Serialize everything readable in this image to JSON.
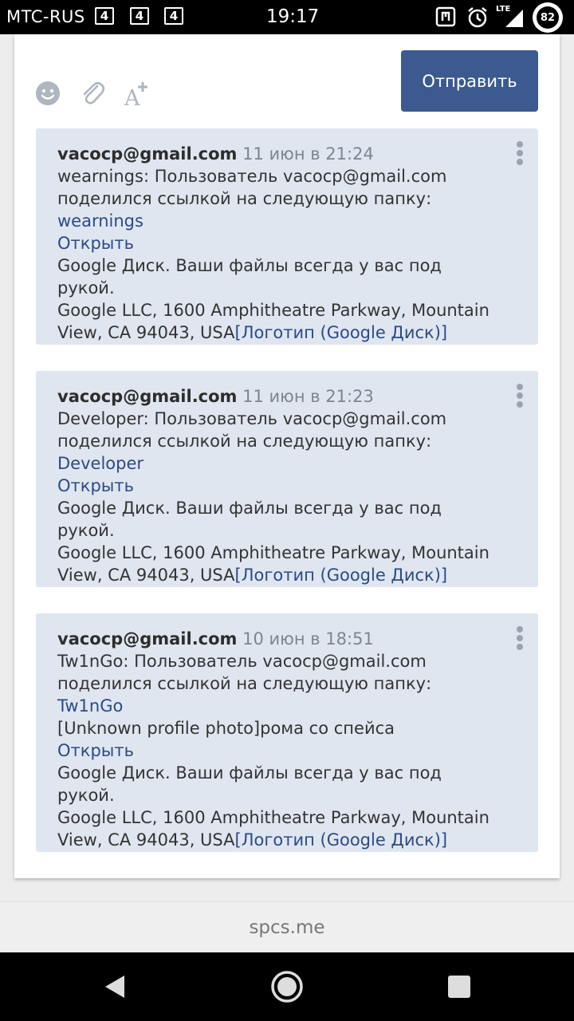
{
  "status_bar": {
    "carrier": "MTC-RUS",
    "network_badges": [
      "4",
      "4",
      "4"
    ],
    "time": "19:17",
    "lte_label": "LTE",
    "battery": "82"
  },
  "composer": {
    "send_label": "Отправить",
    "icons": [
      "smile-icon",
      "paperclip-icon",
      "text-format-icon"
    ]
  },
  "messages": [
    {
      "author": "vacocp@gmail.com",
      "date": "11 июн в 21:24",
      "line1": "wearnings: Пользователь vacocp@gmail.com",
      "line2": "поделился ссылкой на следующую папку:",
      "folder": "wearnings",
      "open": "Открыть",
      "footer1": "Google Диск. Ваши файлы всегда у вас под рукой.",
      "footer2": "Google LLC, 1600 Amphitheatre Parkway, Mountain",
      "footer3": "View, CA 94043, USA",
      "logo": "[Логотип (Google Диск)]"
    },
    {
      "author": "vacocp@gmail.com",
      "date": "11 июн в 21:23",
      "line1": "Developer: Пользователь vacocp@gmail.com",
      "line2": "поделился ссылкой на следующую папку:",
      "folder": "Developer",
      "open": "Открыть",
      "footer1": "Google Диск. Ваши файлы всегда у вас под рукой.",
      "footer2": "Google LLC, 1600 Amphitheatre Parkway, Mountain",
      "footer3": "View, CA 94043, USA",
      "logo": "[Логотип (Google Диск)]"
    },
    {
      "author": "vacocp@gmail.com",
      "date": "10 июн в 18:51",
      "line1": "Tw1nGo: Пользователь vacocp@gmail.com",
      "line2": "поделился ссылкой на следующую папку:",
      "folder": "Tw1nGo",
      "extra": "[Unknown profile photo]рома со спейса",
      "open": "Открыть",
      "footer1": "Google Диск. Ваши файлы всегда у вас под рукой.",
      "footer2": "Google LLC, 1600 Amphitheatre Parkway, Mountain",
      "footer3": "View, CA 94043, USA",
      "logo": "[Логотип (Google Диск)]"
    }
  ],
  "footer": {
    "domain": "spcs.me"
  }
}
